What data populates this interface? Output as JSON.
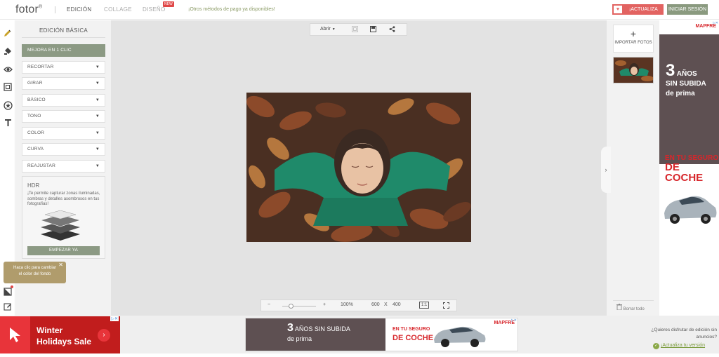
{
  "header": {
    "logo": "fotor",
    "logo_mark": "®",
    "tabs": [
      {
        "label": "EDICIÓN"
      },
      {
        "label": "COLLAGE"
      },
      {
        "label": "DISEÑO"
      }
    ],
    "new_badge": "NEW",
    "promo_text": "¡Otros métodos de pago ya disponibles!",
    "upgrade_label": "¡ACTUALIZA",
    "login_label": "INICIAR SESIÓN"
  },
  "left_panel": {
    "title": "EDICIÓN BÁSICA",
    "enhance_label": "MEJORA EN 1 CLIC",
    "dropdowns": [
      {
        "label": "RECORTAR"
      },
      {
        "label": "GIRAR"
      },
      {
        "label": "BÁSICO"
      },
      {
        "label": "TONO"
      },
      {
        "label": "COLOR"
      },
      {
        "label": "CURVA"
      },
      {
        "label": "REAJUSTAR"
      }
    ],
    "hdr": {
      "title": "HDR",
      "description": "¡Te permite capturar zonas iluminadas, sombras y detalles asombrosos en tus fotografías!",
      "button_label": "EMPEZAR YA"
    }
  },
  "tooltip": {
    "line1": "Haca clic para cambiar",
    "line2": "el color del fondo",
    "close": "✕"
  },
  "canvas": {
    "open_label": "Abrir",
    "zoom": "100%",
    "width": "600",
    "times": "X",
    "height": "400",
    "ratio_label": "1:1",
    "minus": "−",
    "plus": "+"
  },
  "right_panel": {
    "import_plus": "+",
    "import_label": "IMPORTAR FOTOS",
    "clear_label": "Borrar todo",
    "collapse": "›"
  },
  "ad_right": {
    "brand": "MAPFRE",
    "num": "3",
    "line1": "AÑOS",
    "line2": "SIN SUBIDA",
    "line3": "de prima",
    "red1": "EN TU SEGURO",
    "red2": "DE COCHE",
    "adinfo": "▷✕"
  },
  "ad_bottom_left": {
    "line1": "Winter",
    "line2": "Holidays Sale",
    "arrow": "›",
    "adinfo": "▷✕"
  },
  "ad_bottom_center": {
    "num": "3",
    "line1": "AÑOS SIN SUBIDA",
    "line2": "de prima",
    "red1": "EN TU SEGURO",
    "red2": "DE COCHE",
    "brand": "MAPFRE",
    "adinfo": "▷✕"
  },
  "no_ads": {
    "question": "¿Quieres disfrutar de edición sin anuncios?",
    "link": "¡Actualiza tu versión"
  },
  "colors": {
    "accent_green": "#8c9a84",
    "upgrade_red": "#e26361",
    "tooltip_gold": "#b09c6c",
    "mapfre_red": "#d7262b"
  }
}
